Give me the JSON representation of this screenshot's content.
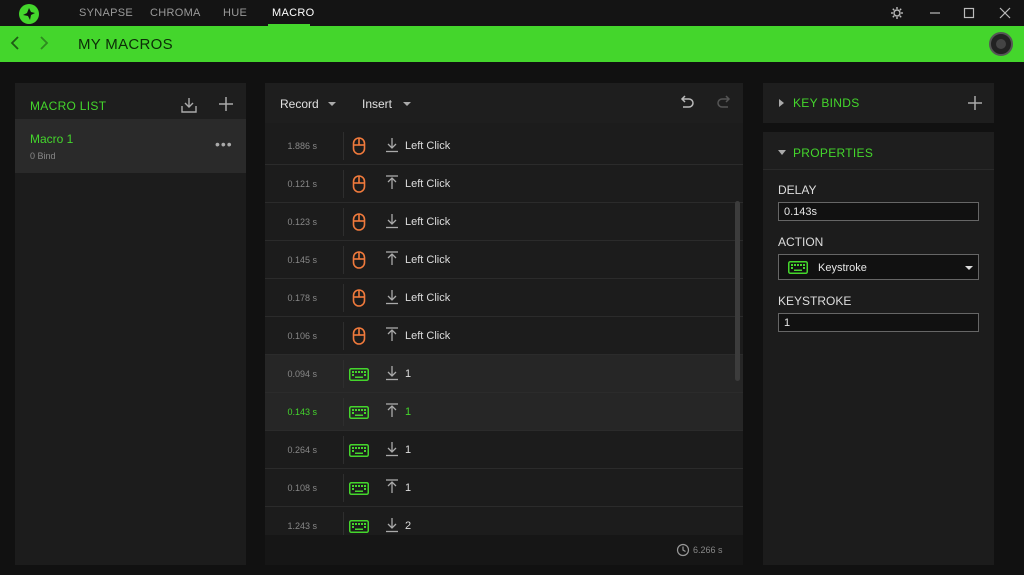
{
  "app": {
    "nav_tabs": [
      {
        "label": "SYNAPSE"
      },
      {
        "label": "CHROMA"
      },
      {
        "label": "HUE"
      },
      {
        "label": "MACRO"
      }
    ],
    "active_tab": "MACRO"
  },
  "header": {
    "title": "MY MACROS"
  },
  "macro_list": {
    "title": "MACRO LIST",
    "items": [
      {
        "name": "Macro 1",
        "binds": "0 Bind"
      }
    ]
  },
  "editor": {
    "record_label": "Record",
    "insert_label": "Insert",
    "rows": [
      {
        "time": "1.886 s",
        "device": "mouse-icon",
        "direction": "down",
        "action": "Left Click"
      },
      {
        "time": "0.121 s",
        "device": "mouse-icon",
        "direction": "up",
        "action": "Left Click"
      },
      {
        "time": "0.123 s",
        "device": "mouse-icon",
        "direction": "down",
        "action": "Left Click"
      },
      {
        "time": "0.145 s",
        "device": "mouse-icon",
        "direction": "up",
        "action": "Left Click"
      },
      {
        "time": "0.178 s",
        "device": "mouse-icon",
        "direction": "down",
        "action": "Left Click"
      },
      {
        "time": "0.106 s",
        "device": "mouse-icon",
        "direction": "up",
        "action": "Left Click"
      },
      {
        "time": "0.094 s",
        "device": "keyboard-icon",
        "direction": "down",
        "action": "1"
      },
      {
        "time": "0.143 s",
        "device": "keyboard-icon",
        "direction": "up",
        "action": "1",
        "selected": true
      },
      {
        "time": "0.264 s",
        "device": "keyboard-icon",
        "direction": "down",
        "action": "1"
      },
      {
        "time": "0.108 s",
        "device": "keyboard-icon",
        "direction": "up",
        "action": "1"
      },
      {
        "time": "1.243 s",
        "device": "keyboard-icon",
        "direction": "down",
        "action": "2"
      }
    ],
    "total_time": "6.266 s"
  },
  "key_binds": {
    "title": "KEY BINDS"
  },
  "properties": {
    "title": "PROPERTIES",
    "delay_label": "DELAY",
    "delay_value": "0.143s",
    "action_label": "ACTION",
    "action_value": "Keystroke",
    "keystroke_label": "KEYSTROKE",
    "keystroke_value": "1"
  },
  "colors": {
    "accent": "#44d62c",
    "mouse_icon": "#f07a3c",
    "keyboard_icon": "#44d62c",
    "background": "#111111",
    "panel": "#1c1c1c"
  }
}
